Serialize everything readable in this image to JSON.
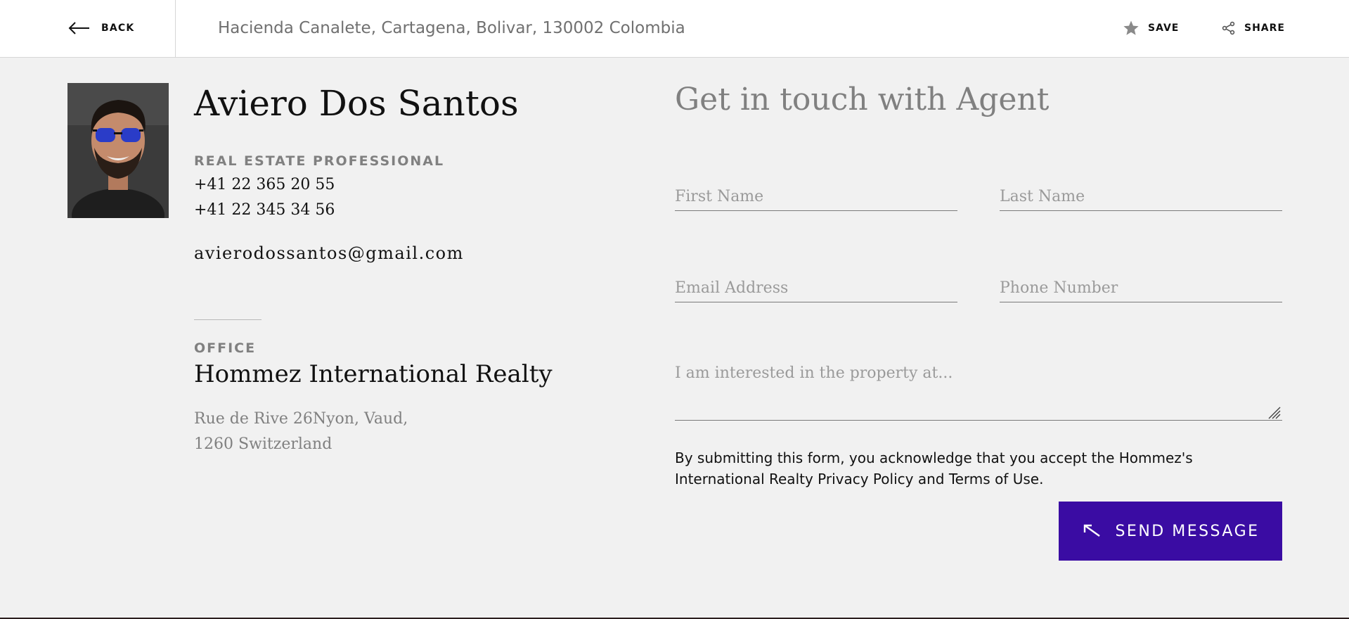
{
  "header": {
    "back_label": "BACK",
    "address": "Hacienda Canalete, Cartagena, Bolivar, 130002 Colombia",
    "save_label": "SAVE",
    "share_label": "SHARE",
    "save_icon": "star-icon",
    "share_icon": "share-icon",
    "back_icon": "arrow-left-icon"
  },
  "agent": {
    "name": "Aviero Dos Santos",
    "role": "REAL ESTATE PROFESSIONAL",
    "phone_1": "+41 22 365 20 55",
    "phone_2": "+41 22 345 34 56",
    "email": "avierodossantos@gmail.com",
    "office_label": "OFFICE",
    "office_name": "Hommez International Realty",
    "office_address_line1": "Rue de Rive 26Nyon, Vaud,",
    "office_address_line2": "1260 Switzerland"
  },
  "contact_form": {
    "title": "Get in touch with Agent",
    "first_name_placeholder": "First Name",
    "last_name_placeholder": "Last Name",
    "email_placeholder": "Email Address",
    "phone_placeholder": "Phone Number",
    "message_placeholder": "I am interested in the property at...",
    "disclaimer_prefix": "By submitting this form, you acknowledge that you accept the Hommez's International Realty ",
    "privacy_link": "Privacy Policy",
    "disclaimer_and": " and ",
    "terms_link": "Terms of Use",
    "disclaimer_suffix": ".",
    "submit_label": "SEND MESSAGE",
    "submit_icon": "arrow-up-left-icon"
  },
  "colors": {
    "accent": "#3a0ca3",
    "background": "#f1f1f1",
    "muted_text": "#808080"
  }
}
